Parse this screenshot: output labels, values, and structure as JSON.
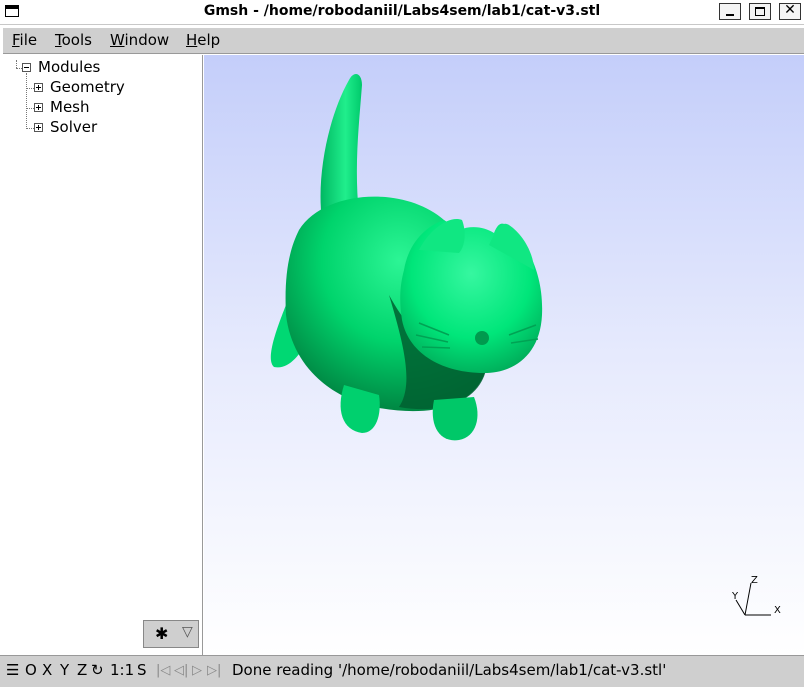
{
  "window": {
    "title": "Gmsh - /home/robodaniil/Labs4sem/lab1/cat-v3.stl"
  },
  "menu": [
    {
      "accel": "F",
      "rest": "ile"
    },
    {
      "accel": "T",
      "rest": "ools"
    },
    {
      "accel": "W",
      "rest": "indow"
    },
    {
      "accel": "H",
      "rest": "elp"
    }
  ],
  "tree": {
    "root": "Modules",
    "children": [
      "Geometry",
      "Mesh",
      "Solver"
    ]
  },
  "status": {
    "axes": [
      "O",
      "X",
      "Y",
      "Z"
    ],
    "scale": "1:1",
    "snap": "S",
    "message": "Done reading '/home/robodaniil/Labs4sem/lab1/cat-v3.stl'"
  },
  "axes_labels": {
    "x": "X",
    "y": "Y",
    "z": "Z"
  },
  "colors": {
    "model": "#00e67a",
    "model_shadow": "#006b34",
    "background_top": "#c4cefa",
    "background_bottom": "#ffffff",
    "panel": "#cfcfcf"
  },
  "icons": [
    "app-icon",
    "minimize-icon",
    "maximize-icon",
    "close-icon",
    "gear-icon",
    "dropdown-icon",
    "menu-icon",
    "rotate-icon",
    "first-icon",
    "prev-icon",
    "next-icon",
    "last-icon"
  ]
}
